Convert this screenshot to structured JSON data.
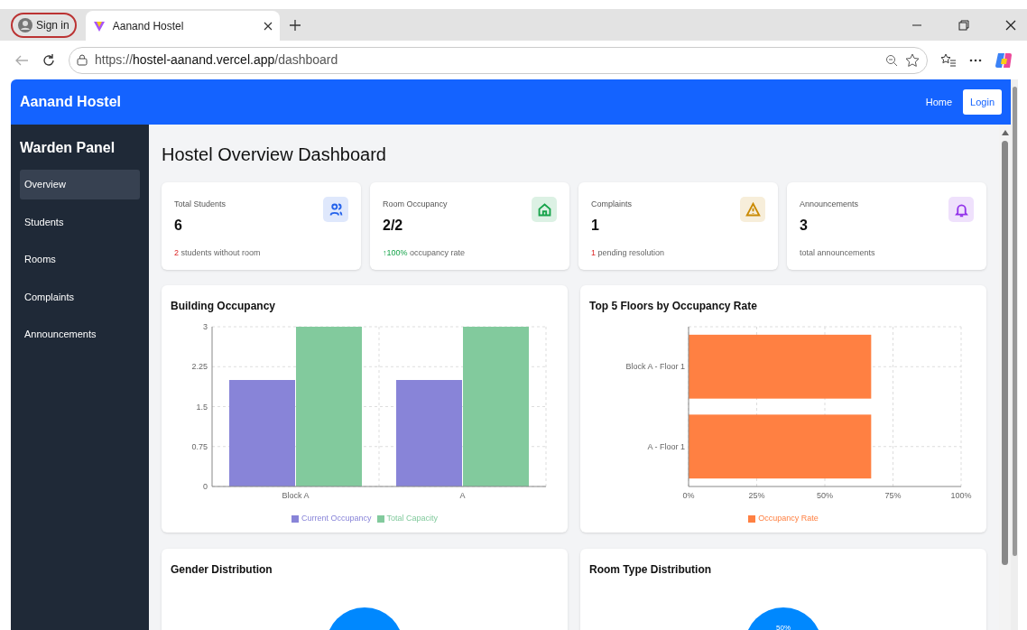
{
  "browser": {
    "profile_label": "Sign in",
    "tab_title": "Aanand Hostel",
    "url_prefix": "https://",
    "url_host": "hostel-aanand.vercel.app",
    "url_path": "/dashboard"
  },
  "navbar": {
    "brand": "Aanand Hostel",
    "links": [
      {
        "label": "Home",
        "kind": "link"
      },
      {
        "label": "Login",
        "kind": "button"
      }
    ]
  },
  "sidebar": {
    "title": "Warden Panel",
    "items": [
      {
        "label": "Overview",
        "selected": true
      },
      {
        "label": "Students",
        "selected": false
      },
      {
        "label": "Rooms",
        "selected": false
      },
      {
        "label": "Complaints",
        "selected": false
      },
      {
        "label": "Announcements",
        "selected": false
      }
    ]
  },
  "page_title": "Hostel Overview Dashboard",
  "stats": [
    {
      "label": "Total Students",
      "value": "6",
      "note_highlight": "2",
      "note": " students without room",
      "kind": "alert",
      "color": "#2563eb"
    },
    {
      "label": "Room Occupancy",
      "value": "2/2",
      "note_highlight": "↑100%",
      "note": " occupancy rate",
      "kind": "positive",
      "color": "#16a34a"
    },
    {
      "label": "Complaints",
      "value": "1",
      "note_highlight": "1",
      "note": " pending resolution",
      "kind": "alert",
      "color": "#ca8a04"
    },
    {
      "label": "Announcements",
      "value": "3",
      "note": "total announcements",
      "kind": "plain",
      "color": "#9333ea"
    }
  ],
  "charts": [
    {
      "title": "Building Occupancy",
      "chart_data": {
        "type": "bar",
        "orientation": "vertical",
        "categories": [
          "Block A",
          "A"
        ],
        "series": [
          {
            "name": "Current Occupancy",
            "color": "#8884d8",
            "values": [
              2,
              2
            ]
          },
          {
            "name": "Total Capacity",
            "color": "#82ca9d",
            "values": [
              3,
              3
            ]
          }
        ],
        "grid": true,
        "ylim": [
          0,
          3
        ],
        "yticks": [
          0,
          0.75,
          1.5,
          2.25,
          3
        ]
      }
    },
    {
      "title": "Top 5 Floors by Occupancy Rate",
      "chart_data": {
        "type": "bar",
        "orientation": "horizontal",
        "categories": [
          "Block A - Floor 1",
          "A - Floor 1"
        ],
        "series": [
          {
            "name": "Occupancy Rate",
            "color": "#ff8042",
            "values": [
              67,
              67
            ]
          }
        ],
        "grid": true,
        "xlim": [
          0,
          100
        ],
        "xticks": [
          {
            "value": 0,
            "label": "0%"
          },
          {
            "value": 25,
            "label": "25%"
          },
          {
            "value": 50,
            "label": "50%"
          },
          {
            "value": 75,
            "label": "75%"
          },
          {
            "value": 100,
            "label": "100%"
          }
        ]
      }
    }
  ],
  "pies": [
    {
      "title": "Gender Distribution"
    },
    {
      "title": "Room Type Distribution",
      "slice_label": "50%"
    }
  ]
}
